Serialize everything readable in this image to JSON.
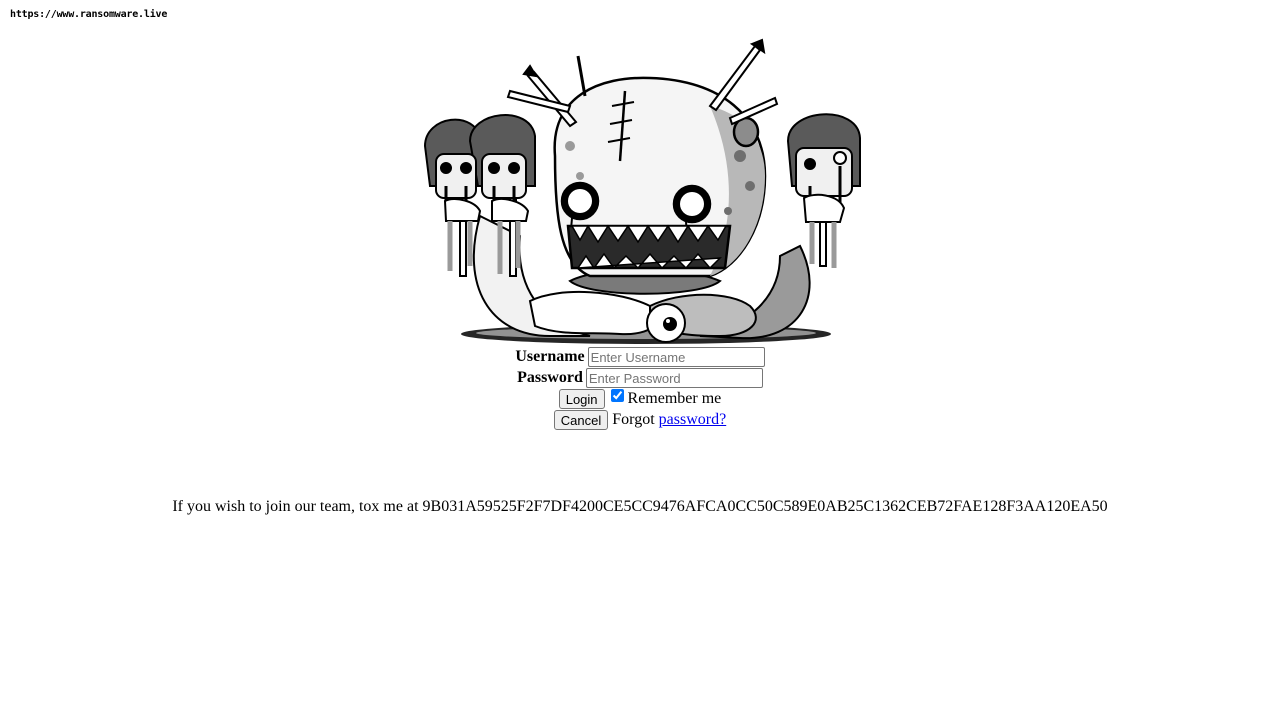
{
  "source_url": "https://www.ransomware.live",
  "illustration": {
    "icon": "monster-illustration-icon"
  },
  "form": {
    "username_label": "Username",
    "username_placeholder": "Enter Username",
    "username_value": "",
    "password_label": "Password",
    "password_placeholder": "Enter Password",
    "password_value": "",
    "login_label": "Login",
    "remember_label": "Remember me",
    "remember_checked": true,
    "cancel_label": "Cancel",
    "forgot_text": "Forgot",
    "forgot_link": "password?"
  },
  "footer": {
    "tox_prefix": "If you wish to join our team, tox me at",
    "tox_id": "9B031A59525F2F7DF4200CE5CC9476AFCA0CC50C589E0AB25C1362CEB72FAE128F3AA120EA50"
  },
  "colors": {
    "link": "#0000ee",
    "checkbox_accent": "#0075ff"
  }
}
